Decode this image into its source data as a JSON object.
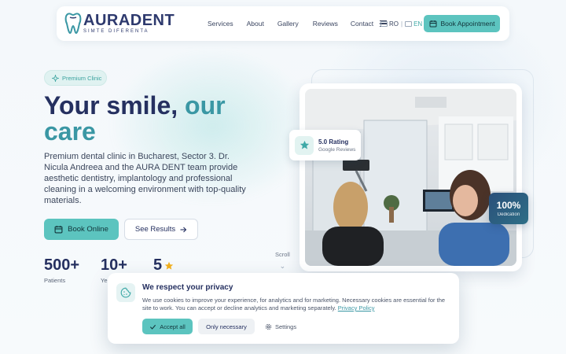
{
  "brand": {
    "name": "AURADENT",
    "tagline": "SIMTE DIFERENTA"
  },
  "nav": {
    "items": [
      "Services",
      "About",
      "Gallery",
      "Reviews",
      "Contact"
    ],
    "lang": {
      "ro": "RO",
      "en": "EN",
      "active": "EN"
    },
    "cta": "Book Appointment"
  },
  "hero": {
    "badge": "Premium Clinic",
    "headline_part1": "Your smile,",
    "headline_accent": "our",
    "headline_part2": "care",
    "description": "Premium dental clinic in Bucharest, Sector 3. Dr. Nicula Andreea and the AURA DENT team provide aesthetic dentistry, implantology and professional cleaning in a welcoming environment with top-quality materials.",
    "btn_online": "Book Online",
    "btn_results": "See Results",
    "stats": [
      {
        "value": "500+",
        "label": "Patients"
      },
      {
        "value": "10+",
        "label": "Ye"
      },
      {
        "value": "5",
        "label": ""
      }
    ],
    "scroll_label": "Scroll"
  },
  "rating_card": {
    "title": "5.0 Rating",
    "subtitle": "Google Reviews"
  },
  "dedication_card": {
    "value": "100%",
    "label": "Dedication"
  },
  "cookie": {
    "title": "We respect your privacy",
    "text": "We use cookies to improve your experience, for analytics and for marketing. Necessary cookies are essential for the site to work. You can accept or decline analytics and marketing separately.",
    "policy_link": "Privacy Policy",
    "accept": "Accept all",
    "necessary": "Only necessary",
    "settings": "Settings"
  },
  "colors": {
    "accent": "#5cc4bf",
    "navy": "#253060",
    "teal_text": "#3a97a4",
    "star": "#f2b01e"
  }
}
